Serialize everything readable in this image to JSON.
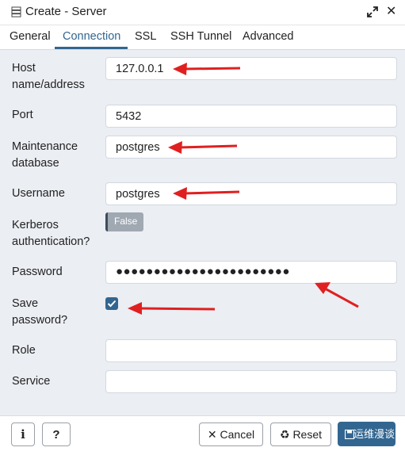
{
  "window": {
    "title": "Create - Server",
    "icon": "server-icon"
  },
  "tabs": [
    {
      "label": "General"
    },
    {
      "label": "Connection",
      "active": true
    },
    {
      "label": "SSL"
    },
    {
      "label": "SSH Tunnel"
    },
    {
      "label": "Advanced"
    }
  ],
  "form": {
    "host": {
      "label_line1": "Host",
      "label_line2": "name/address",
      "value": "127.0.0.1"
    },
    "port": {
      "label": "Port",
      "value": "5432"
    },
    "maintenance_db": {
      "label_line1": "Maintenance",
      "label_line2": "database",
      "value": "postgres"
    },
    "username": {
      "label": "Username",
      "value": "postgres"
    },
    "kerberos": {
      "label_line1": "Kerberos",
      "label_line2": "authentication?",
      "toggle_label": "False"
    },
    "password": {
      "label": "Password",
      "value": "●●●●●●●●●●●●●●●●●●●●●●●"
    },
    "save_password": {
      "label_line1": "Save",
      "label_line2": "password?",
      "checked": true
    },
    "role": {
      "label": "Role",
      "value": ""
    },
    "service": {
      "label": "Service",
      "value": ""
    }
  },
  "footer": {
    "info_label": "i",
    "help_label": "?",
    "cancel_label": "Cancel",
    "reset_label": "Reset",
    "save_label": "运维漫谈"
  },
  "colors": {
    "accent": "#326690",
    "annotation_arrow": "#e02020",
    "form_bg": "#ebeef3"
  }
}
